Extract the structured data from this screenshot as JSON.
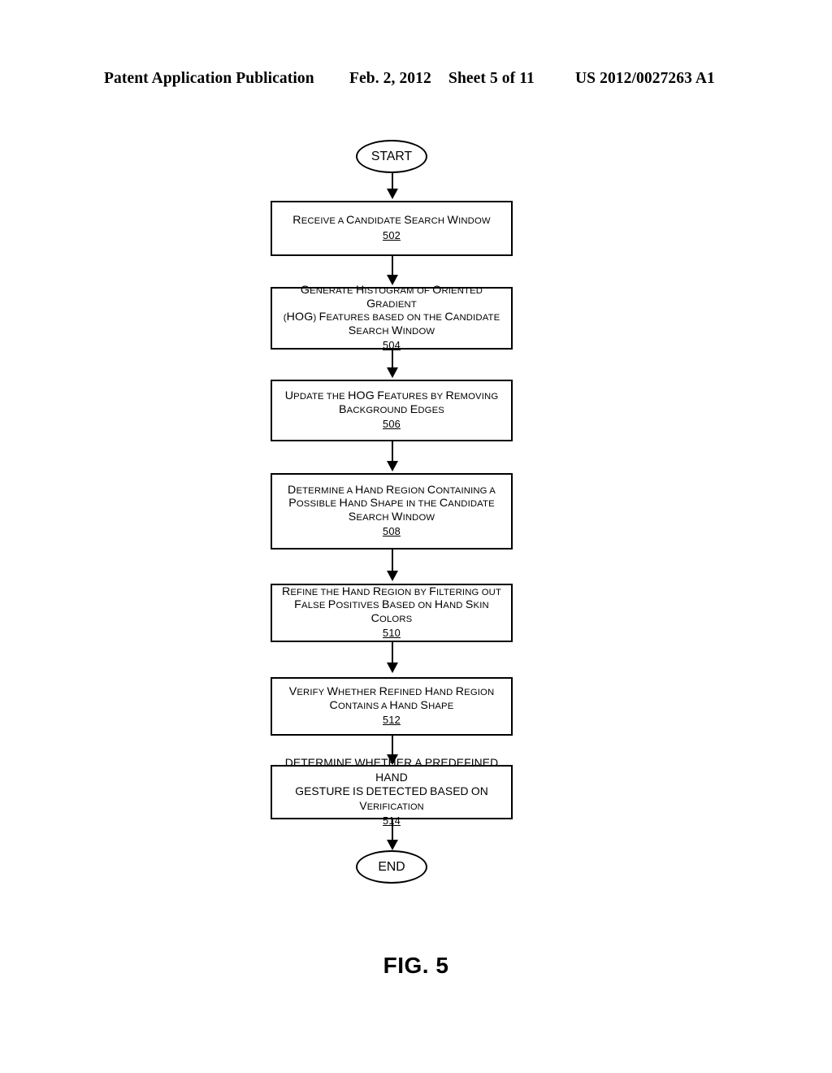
{
  "header": {
    "publication": "Patent Application Publication",
    "date": "Feb. 2, 2012",
    "sheet": "Sheet 5 of 11",
    "publication_number": "US 2012/0027263 A1"
  },
  "figure": {
    "caption": "FIG. 5",
    "type": "flowchart",
    "ink_color": "#000000",
    "background_color": "#ffffff"
  },
  "flowchart": {
    "start": {
      "label": "START",
      "shape": "oval"
    },
    "end": {
      "label": "END",
      "shape": "oval"
    },
    "steps": [
      {
        "ref": "502",
        "shape": "rectangle",
        "lines": [
          "Receive a Candidate Search Window"
        ],
        "text": "Receive a Candidate Search Window"
      },
      {
        "ref": "504",
        "shape": "rectangle",
        "lines": [
          "Generate Histogram of Oriented Gradient",
          "(HOG) Features based on the Candidate",
          "Search Window"
        ],
        "text": "Generate Histogram of Oriented Gradient (HOG) Features based on the Candidate Search Window"
      },
      {
        "ref": "506",
        "shape": "rectangle",
        "lines": [
          "Update the HOG Features by Removing",
          "Background Edges"
        ],
        "text": "Update the HOG Features by Removing Background Edges"
      },
      {
        "ref": "508",
        "shape": "rectangle",
        "lines": [
          "Determine a Hand Region Containing a",
          "Possible Hand Shape in the Candidate",
          "Search Window"
        ],
        "text": "Determine a Hand Region Containing a Possible Hand Shape in the Candidate Search Window"
      },
      {
        "ref": "510",
        "shape": "rectangle",
        "lines": [
          "Refine the Hand Region by Filtering out",
          "False Positives Based on Hand Skin Colors"
        ],
        "text": "Refine the Hand Region by Filtering out False Positives Based on Hand Skin Colors"
      },
      {
        "ref": "512",
        "shape": "rectangle",
        "lines": [
          "Verify Whether Refined Hand Region",
          "Contains a Hand Shape"
        ],
        "text": "Verify Whether Refined Hand Region Contains a Hand Shape"
      },
      {
        "ref": "514",
        "shape": "rectangle",
        "lines": [
          "DETERMINE WHETHER A PREDEFINED HAND",
          "GESTURE IS DETECTED BASED ON Verification"
        ],
        "text": "DETERMINE WHETHER A PREDEFINED HAND GESTURE IS DETECTED BASED ON VERIFICATION"
      }
    ],
    "flow_order": [
      "START",
      "502",
      "504",
      "506",
      "508",
      "510",
      "512",
      "514",
      "END"
    ]
  }
}
